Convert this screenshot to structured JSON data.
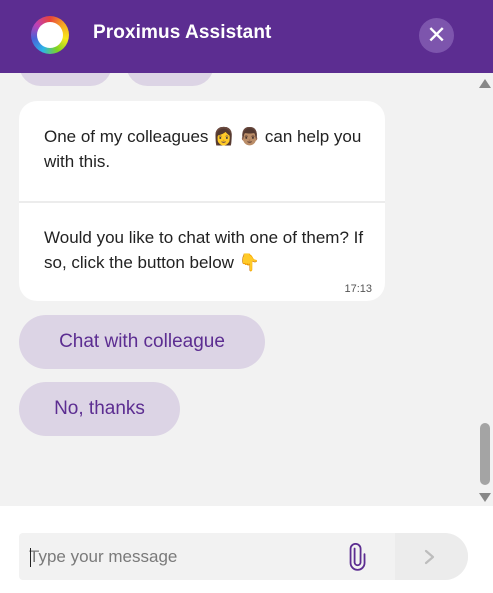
{
  "header": {
    "title": "Proximus Assistant",
    "close_label": "✕"
  },
  "messages": {
    "line1": "One of my colleagues 👩 👨🏽 can help you with this.",
    "line2": "Would you like to chat with one of them? If so, click the button below 👇",
    "time": "17:13"
  },
  "quick_replies": {
    "chat": "Chat with colleague",
    "no": "No, thanks"
  },
  "composer": {
    "placeholder": "Type your message",
    "value": ""
  },
  "colors": {
    "brand": "#5c2d91",
    "chip": "#dcd4e5"
  },
  "icons": {
    "attach": "paperclip-icon",
    "send": "chevron-right-icon",
    "close": "close-icon"
  }
}
